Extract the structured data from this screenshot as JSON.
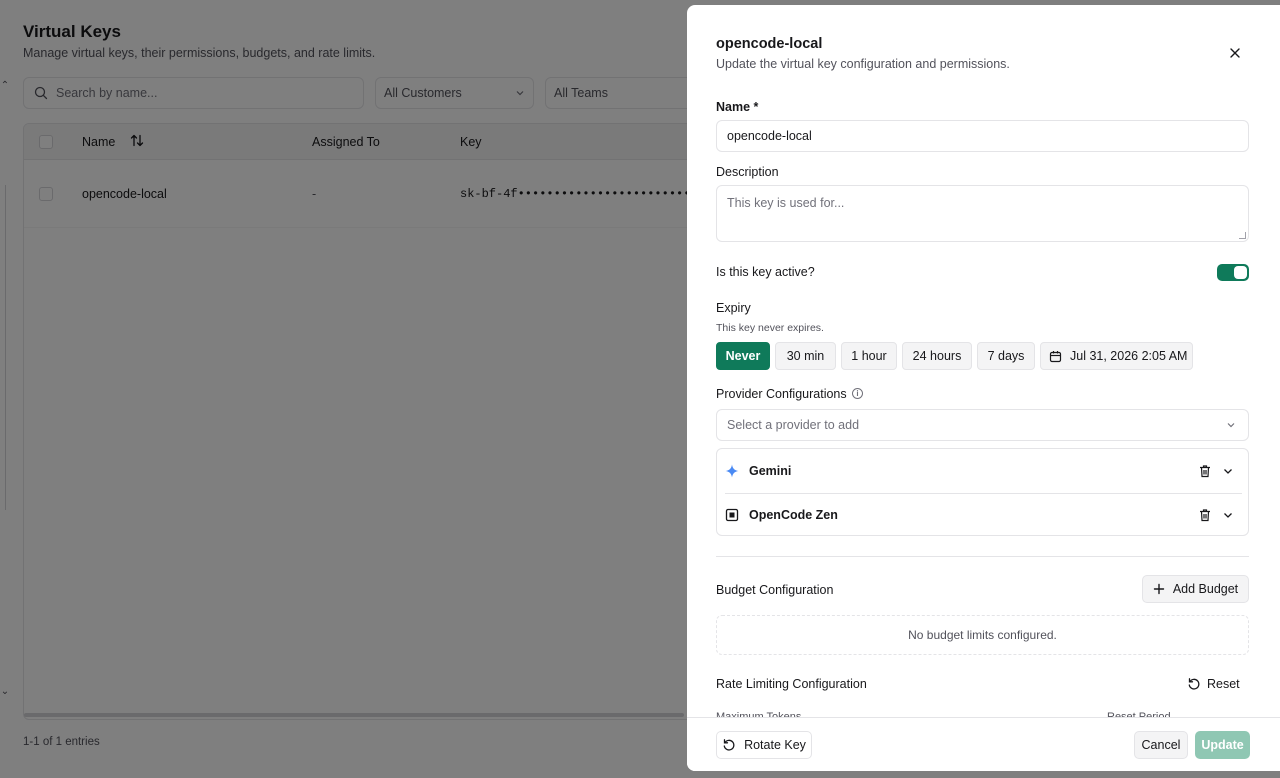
{
  "page": {
    "title": "Virtual Keys",
    "subtitle": "Manage virtual keys, their permissions, budgets, and rate limits.",
    "search_placeholder": "Search by name...",
    "filters": [
      "All Customers",
      "All Teams"
    ],
    "table": {
      "headers": [
        "Name",
        "Assigned To",
        "Key"
      ],
      "rows": [
        {
          "name": "opencode-local",
          "assigned_to": "-",
          "key": "sk-bf-4f••••••••••••••••••••••••"
        }
      ]
    },
    "entries_text": "1-1 of 1 entries"
  },
  "drawer": {
    "title": "opencode-local",
    "subtitle": "Update the virtual key configuration and permissions.",
    "name_label": "Name *",
    "name_value": "opencode-local",
    "description_label": "Description",
    "description_placeholder": "This key is used for...",
    "active_label": "Is this key active?",
    "active": true,
    "expiry_label": "Expiry",
    "expiry_hint": "This key never expires.",
    "expiry_options": [
      "Never",
      "30 min",
      "1 hour",
      "24 hours",
      "7 days"
    ],
    "expiry_selected": "Never",
    "expiry_date": "Jul 31, 2026 2:05 AM",
    "provider_label": "Provider Configurations",
    "provider_placeholder": "Select a provider to add",
    "providers": [
      "Gemini",
      "OpenCode Zen"
    ],
    "budget_label": "Budget Configuration",
    "add_budget": "Add Budget",
    "no_budget": "No budget limits configured.",
    "rate_label": "Rate Limiting Configuration",
    "reset": "Reset",
    "max_tokens_label": "Maximum Tokens",
    "reset_period_label": "Reset Period",
    "rotate_key": "Rotate Key",
    "cancel": "Cancel",
    "update": "Update"
  },
  "colors": {
    "accent": "#0f7a5a",
    "accent_disabled": "#8fc7b3",
    "overlay": "rgba(0,0,0,0.5)"
  }
}
